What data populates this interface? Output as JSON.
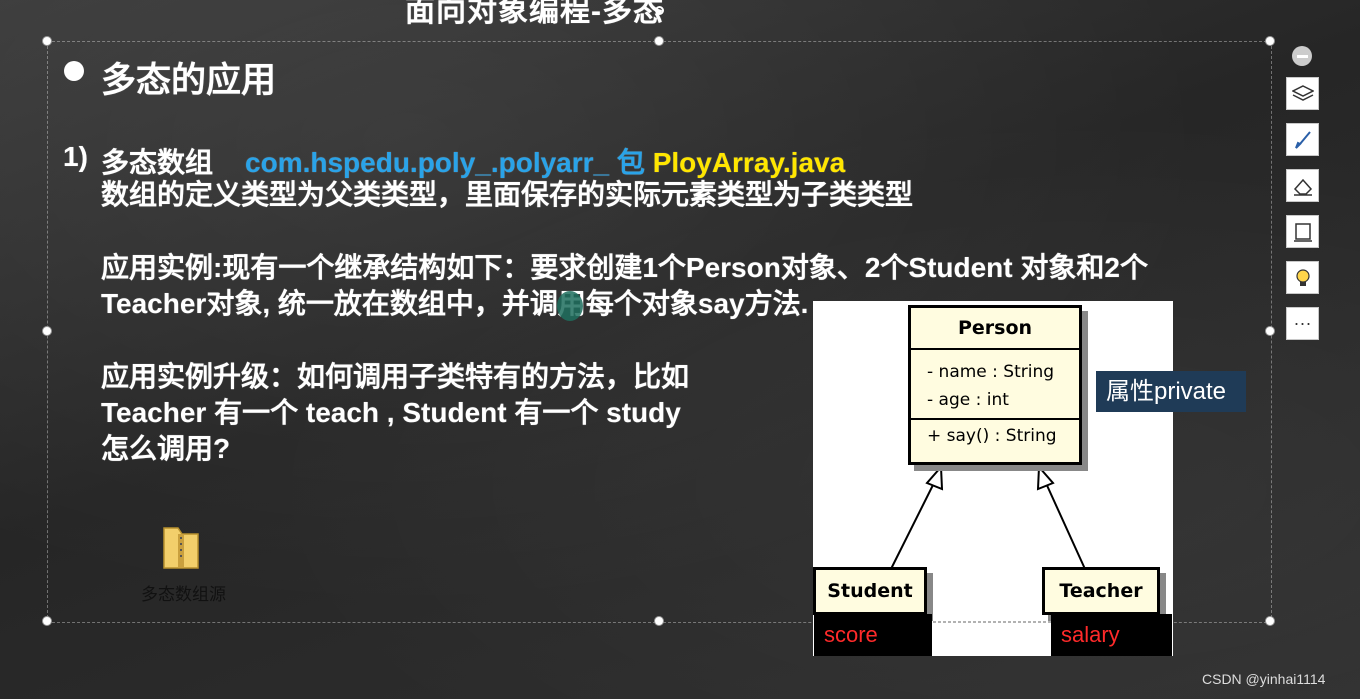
{
  "slide": {
    "top_title": "面向对象编程-多态",
    "heading": "多态的应用",
    "item_number": "1)",
    "item_title": "多态数组",
    "package": "com.hspedu.poly_.polyarr_ 包",
    "file": "PloyArray.java",
    "desc": "数组的定义类型为父类类型，里面保存的实际元素类型为子类类型",
    "example_line1": "应用实例:现有一个继承结构如下：要求创建1个Person对象、2个Student 对象和2个",
    "example_line2": "Teacher对象, 统一放在数组中，并调用每个对象say方法.",
    "upgrade_line1": "应用实例升级：如何调用子类特有的方法，比如",
    "upgrade_line2": "Teacher 有一个 teach , Student 有一个 study",
    "upgrade_line3": "怎么调用?",
    "folder_label": "多态数组源"
  },
  "uml": {
    "person": {
      "name": "Person",
      "attr1": "- name : String",
      "attr2": "- age : int",
      "method": "+ say() : String"
    },
    "student": {
      "name": "Student"
    },
    "teacher": {
      "name": "Teacher"
    },
    "attr_note": "属性private",
    "student_extra": "score",
    "teacher_extra": "salary"
  },
  "toolbar": {
    "icons": [
      "minus-icon",
      "layers-icon",
      "brush-icon",
      "eraser-icon",
      "frame-icon",
      "lightbulb-icon",
      "more-icon"
    ],
    "more_label": "···"
  },
  "watermark": "CSDN @yinhai1114",
  "colors": {
    "package": "#2aa3e8",
    "file": "#ffe600",
    "note_bg": "#1f3b57",
    "extra_text": "#ff2a2a"
  }
}
